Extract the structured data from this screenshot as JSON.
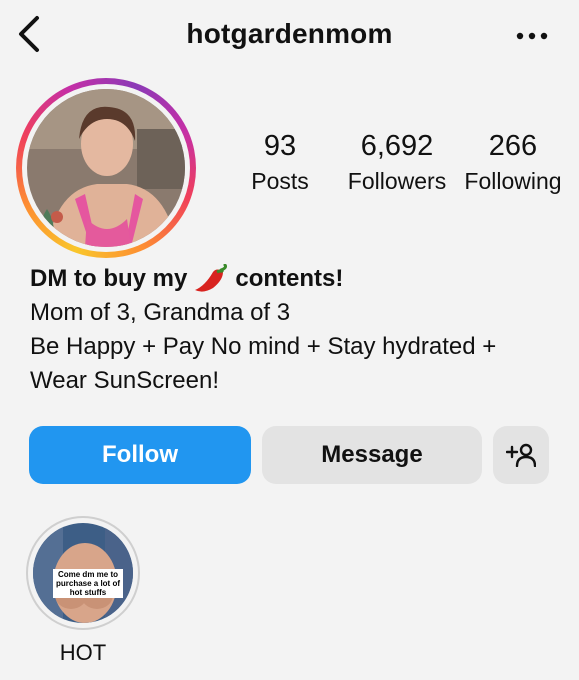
{
  "header": {
    "username": "hotgardenmom"
  },
  "stats": [
    {
      "value": "93",
      "label": "Posts"
    },
    {
      "value": "6,692",
      "label": "Followers"
    },
    {
      "value": "266",
      "label": "Following"
    }
  ],
  "bio": {
    "headline_before": "DM to buy my",
    "headline_after": "contents!",
    "line1": "Mom of 3, Grandma of 3",
    "line2": "Be Happy + Pay No mind + Stay hydrated +",
    "line3": "Wear SunScreen!"
  },
  "actions": {
    "follow": "Follow",
    "message": "Message"
  },
  "highlights": [
    {
      "label": "HOT",
      "caption": "Come dm me to purchase a lot of hot stuffs"
    }
  ],
  "colors": {
    "follow_button": "#2196f0",
    "secondary_button": "#e3e3e3",
    "background": "#f3f3f3"
  },
  "icons": {
    "back": "chevron-left-icon",
    "more": "more-horizontal-icon",
    "add_user": "add-user-icon",
    "pepper": "chili-pepper-emoji"
  }
}
